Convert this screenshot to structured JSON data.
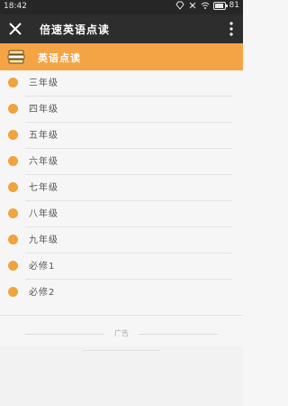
{
  "status_bar": {
    "time": "18:42",
    "battery": "81",
    "icons": [
      "diamond-icon",
      "signal-icon",
      "wifi-icon",
      "battery-icon"
    ]
  },
  "app_bar": {
    "title": "倍速英语点读",
    "close_icon": "close-icon",
    "more_icon": "more-vertical-icon"
  },
  "section": {
    "title": "英语点读",
    "accent": "#f5a445"
  },
  "list": {
    "items": [
      "三年级",
      "四年级",
      "五年级",
      "六年级",
      "七年级",
      "八年级",
      "九年级",
      "必修1",
      "必修2"
    ]
  },
  "ad": {
    "label": "广告"
  }
}
